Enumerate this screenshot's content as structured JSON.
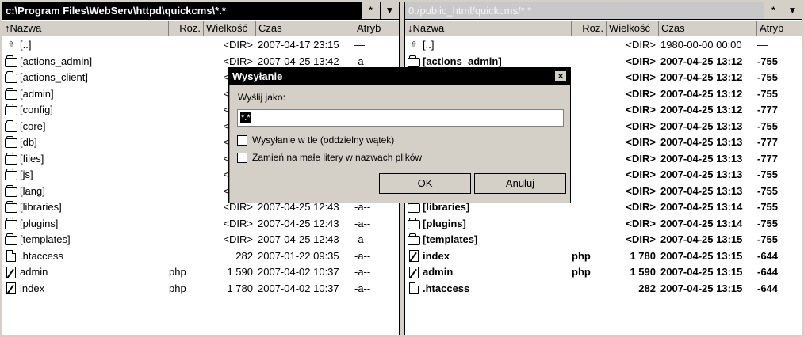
{
  "left": {
    "path": "c:\\Program Files\\WebServ\\httpd\\quickcms\\*.*",
    "star_btn": "*",
    "menu_btn": "▼",
    "headers": {
      "name": "↑Nazwa",
      "ext": "Roz.",
      "size": "Wielkość",
      "time": "Czas",
      "attr": "Atryb"
    },
    "rows": [
      {
        "icon": "up",
        "name": "[..]",
        "ext": "",
        "size": "<DIR>",
        "time": "2007-04-17 23:15",
        "attr": "—"
      },
      {
        "icon": "folder",
        "name": "[actions_admin]",
        "ext": "",
        "size": "<DIR>",
        "time": "2007-04-25 13:42",
        "attr": "-a--"
      },
      {
        "icon": "folder",
        "name": "[actions_client]",
        "ext": "",
        "size": "<DIR>",
        "time": "",
        "attr": ""
      },
      {
        "icon": "folder",
        "name": "[admin]",
        "ext": "",
        "size": "<DIR>",
        "time": "",
        "attr": ""
      },
      {
        "icon": "folder",
        "name": "[config]",
        "ext": "",
        "size": "<DIR>",
        "time": "",
        "attr": ""
      },
      {
        "icon": "folder",
        "name": "[core]",
        "ext": "",
        "size": "<DIR>",
        "time": "",
        "attr": ""
      },
      {
        "icon": "folder",
        "name": "[db]",
        "ext": "",
        "size": "<DIR>",
        "time": "",
        "attr": ""
      },
      {
        "icon": "folder",
        "name": "[files]",
        "ext": "",
        "size": "<DIR>",
        "time": "",
        "attr": ""
      },
      {
        "icon": "folder",
        "name": "[js]",
        "ext": "",
        "size": "<DIR>",
        "time": "",
        "attr": ""
      },
      {
        "icon": "folder",
        "name": "[lang]",
        "ext": "",
        "size": "<DIR>",
        "time": "",
        "attr": ""
      },
      {
        "icon": "folder",
        "name": "[libraries]",
        "ext": "",
        "size": "<DIR>",
        "time": "2007-04-25 12:43",
        "attr": "-a--"
      },
      {
        "icon": "folder",
        "name": "[plugins]",
        "ext": "",
        "size": "<DIR>",
        "time": "2007-04-25 12:43",
        "attr": "-a--"
      },
      {
        "icon": "folder",
        "name": "[templates]",
        "ext": "",
        "size": "<DIR>",
        "time": "2007-04-25 12:43",
        "attr": "-a--"
      },
      {
        "icon": "file",
        "name": ".htaccess",
        "ext": "",
        "size": "282",
        "time": "2007-01-22 09:35",
        "attr": "-a--"
      },
      {
        "icon": "edit",
        "name": "admin",
        "ext": "php",
        "size": "1 590",
        "time": "2007-04-02 10:37",
        "attr": "-a--"
      },
      {
        "icon": "edit",
        "name": "index",
        "ext": "php",
        "size": "1 780",
        "time": "2007-04-02 10:37",
        "attr": "-a--"
      }
    ]
  },
  "right": {
    "path": "0:/public_html/quickcms/*.*",
    "star_btn": "*",
    "menu_btn": "▼",
    "headers": {
      "name": "↓Nazwa",
      "ext": "Roz.",
      "size": "Wielkość",
      "time": "Czas",
      "attr": "Atryb"
    },
    "rows": [
      {
        "icon": "up",
        "name": "[..]",
        "ext": "",
        "size": "<DIR>",
        "time": "1980-00-00 00:00",
        "attr": "—"
      },
      {
        "icon": "folder",
        "name": "[actions_admin]",
        "ext": "",
        "size": "<DIR>",
        "time": "2007-04-25 13:12",
        "attr": "-755"
      },
      {
        "icon": "folder",
        "name": "",
        "ext": "",
        "size": "<DIR>",
        "time": "2007-04-25 13:12",
        "attr": "-755"
      },
      {
        "icon": "folder",
        "name": "",
        "ext": "",
        "size": "<DIR>",
        "time": "2007-04-25 13:12",
        "attr": "-755"
      },
      {
        "icon": "folder",
        "name": "",
        "ext": "",
        "size": "<DIR>",
        "time": "2007-04-25 13:12",
        "attr": "-777"
      },
      {
        "icon": "folder",
        "name": "",
        "ext": "",
        "size": "<DIR>",
        "time": "2007-04-25 13:13",
        "attr": "-755"
      },
      {
        "icon": "folder",
        "name": "",
        "ext": "",
        "size": "<DIR>",
        "time": "2007-04-25 13:13",
        "attr": "-777"
      },
      {
        "icon": "folder",
        "name": "",
        "ext": "",
        "size": "<DIR>",
        "time": "2007-04-25 13:13",
        "attr": "-777"
      },
      {
        "icon": "folder",
        "name": "",
        "ext": "",
        "size": "<DIR>",
        "time": "2007-04-25 13:13",
        "attr": "-755"
      },
      {
        "icon": "folder",
        "name": "",
        "ext": "",
        "size": "<DIR>",
        "time": "2007-04-25 13:13",
        "attr": "-755"
      },
      {
        "icon": "folder",
        "name": "[libraries]",
        "ext": "",
        "size": "<DIR>",
        "time": "2007-04-25 13:14",
        "attr": "-755"
      },
      {
        "icon": "folder",
        "name": "[plugins]",
        "ext": "",
        "size": "<DIR>",
        "time": "2007-04-25 13:14",
        "attr": "-755"
      },
      {
        "icon": "folder",
        "name": "[templates]",
        "ext": "",
        "size": "<DIR>",
        "time": "2007-04-25 13:15",
        "attr": "-755"
      },
      {
        "icon": "edit",
        "name": "index",
        "ext": "php",
        "size": "1 780",
        "time": "2007-04-25 13:15",
        "attr": "-644"
      },
      {
        "icon": "edit",
        "name": "admin",
        "ext": "php",
        "size": "1 590",
        "time": "2007-04-25 13:15",
        "attr": "-644"
      },
      {
        "icon": "file",
        "name": ".htaccess",
        "ext": "",
        "size": "282",
        "time": "2007-04-25 13:15",
        "attr": "-644"
      }
    ]
  },
  "dialog": {
    "title": "Wysyłanie",
    "close": "×",
    "label": "Wyślij jako:",
    "input_value": "*.*",
    "checkbox1": "Wysyłanie w tle (oddzielny wątek)",
    "checkbox2": "Zamień na małe litery w nazwach plików",
    "ok": "OK",
    "cancel": "Anuluj"
  }
}
